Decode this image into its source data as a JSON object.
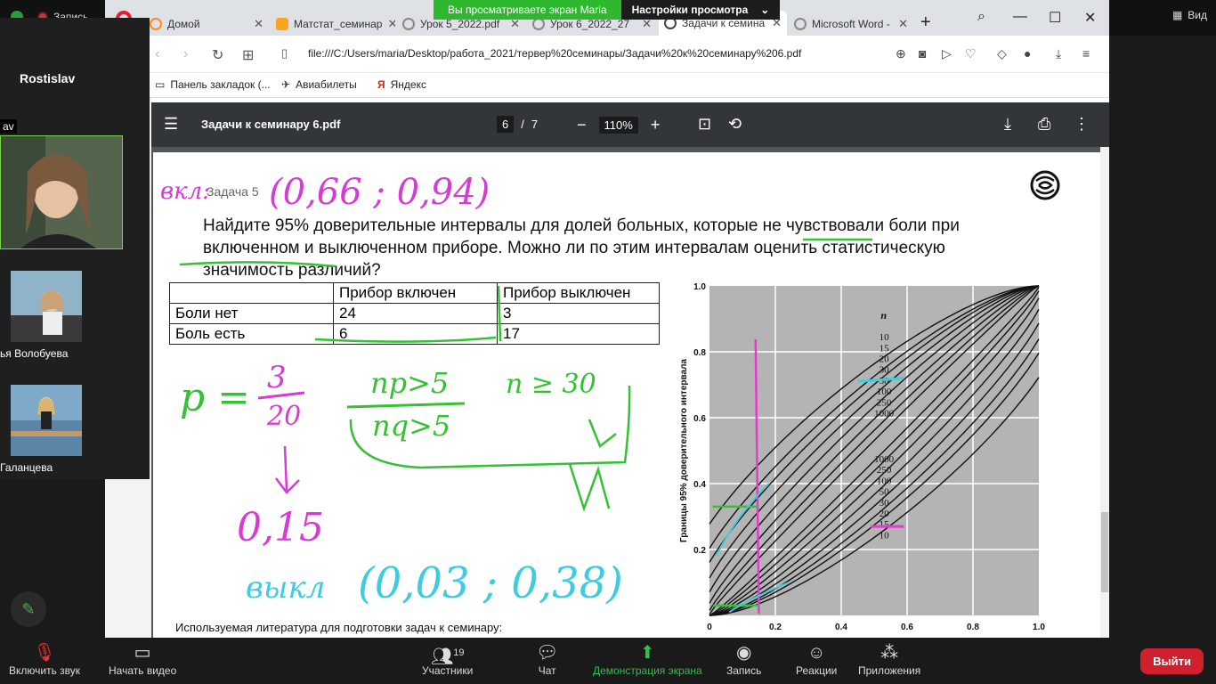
{
  "zoom": {
    "record_label": "Запись",
    "view_label": "Вид",
    "share_banner": "Вы просматриваете экран Maria",
    "view_options": "Настройки просмотра",
    "participants": [
      {
        "name": "Rostislav"
      },
      {
        "name": "av"
      },
      {
        "name": "ья Волобуева"
      },
      {
        "name": "Галанцева"
      }
    ],
    "bottom": {
      "mic": "Включить звук",
      "video": "Начать видео",
      "participants": "Участники",
      "participants_count": "19",
      "chat": "Чат",
      "share": "Демонстрация экрана",
      "record": "Запись",
      "reactions": "Реакции",
      "apps": "Приложения",
      "exit": "Выйти"
    }
  },
  "browser": {
    "tabs": [
      {
        "label": "Домой",
        "color": "#ff8c1a"
      },
      {
        "label": "Матстат_семинар",
        "color": "#f5a623"
      },
      {
        "label": "Урок 5_2022.pdf",
        "color": "#888888"
      },
      {
        "label": "Урок 6_2022_27",
        "color": "#888888"
      },
      {
        "label": "Задачи к семина",
        "color": "#444444"
      },
      {
        "label": "Microsoft Word -",
        "color": "#888888"
      }
    ],
    "url": "file:///C:/Users/maria/Desktop/работа_2021/тервер%20семинары/Задачи%20к%20семинару%206.pdf",
    "bookmarks": [
      {
        "label": "Панель закладок (..."
      },
      {
        "label": "Авиабилеты"
      },
      {
        "label": "Яндекс"
      }
    ]
  },
  "pdf": {
    "title": "Задачи к семинару 6.pdf",
    "page_current": "6",
    "page_sep": "/",
    "page_total": "7",
    "zoom": "110%",
    "task_label": "Задача 5",
    "task_text": "Найдите 95% доверительные интервалы для долей больных, которые не чувствовали боли при включенном и выключенном приборе. Можно ли по этим интервалам оценить статистическую значимость различий?",
    "table": {
      "headers": [
        "",
        "Прибор включен",
        "Прибор выключен"
      ],
      "rows": [
        [
          "Боли нет",
          "24",
          "3"
        ],
        [
          "Боль есть",
          "6",
          "17"
        ]
      ]
    },
    "literature": "Используемая литература для подготовки задач к семинару:",
    "annotations": {
      "top": "(0,66 ; 0,94)",
      "formula_p": "p =",
      "formula_num": "3",
      "formula_den": "20",
      "np_top": "np>5",
      "np_bottom": "nq>5",
      "n_cond": "n ≥ 30",
      "result": "0,15",
      "interval": "(0,03 ; 0,38)"
    }
  },
  "chart_data": {
    "type": "line",
    "ylabel": "Границы 95% доверительного интервала",
    "legend_title": "n",
    "n_labels_upper": [
      "10",
      "15",
      "20",
      "30",
      "50",
      "100",
      "250",
      "1000"
    ],
    "n_labels_lower": [
      "1000",
      "250",
      "100",
      "50",
      "30",
      "20",
      "15",
      "10"
    ],
    "x_ticks": [
      "0",
      "0.2",
      "0.4",
      "0.6",
      "0.8",
      "1.0"
    ],
    "y_ticks": [
      "0.2",
      "0.4",
      "0.6",
      "0.8",
      "1.0"
    ],
    "xlim": [
      0,
      1
    ],
    "ylim": [
      0,
      1
    ]
  }
}
